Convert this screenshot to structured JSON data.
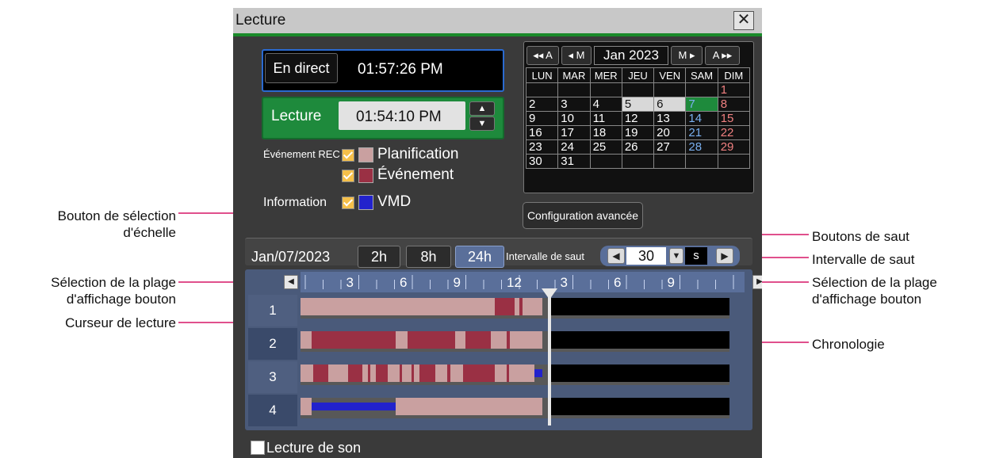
{
  "annotations": {
    "scale_button": "Bouton de sélection\nd'échelle",
    "display_range_left": "Sélection de la plage\nd'affichage bouton",
    "playback_cursor": "Curseur de lecture",
    "jump_buttons": "Boutons de saut",
    "jump_interval": "Intervalle de saut",
    "display_range_right": "Sélection de la plage\nd'affichage bouton",
    "timeline": "Chronologie"
  },
  "window": {
    "title": "Lecture",
    "close": "✕"
  },
  "live": {
    "button": "En direct",
    "time": "01:57:26 PM"
  },
  "playback": {
    "button": "Lecture",
    "time": "01:54:10 PM"
  },
  "filters": {
    "rec_label": "Événement REC",
    "schedule": "Planification",
    "event": "Événement",
    "info_label": "Information",
    "vmd": "VMD"
  },
  "advanced": "Configuration avancée",
  "calendar": {
    "nav": [
      "◂◂ A",
      "◂ M",
      "Jan 2023",
      "M ▸",
      "A ▸▸"
    ],
    "days": [
      "LUN",
      "MAR",
      "MER",
      "JEU",
      "VEN",
      "SAM",
      "DIM"
    ],
    "weeks": [
      [
        "",
        "",
        "",
        "",
        "",
        "",
        "1"
      ],
      [
        "2",
        "3",
        "4",
        "5",
        "6",
        "7",
        "8"
      ],
      [
        "9",
        "10",
        "11",
        "12",
        "13",
        "14",
        "15"
      ],
      [
        "16",
        "17",
        "18",
        "19",
        "20",
        "21",
        "22"
      ],
      [
        "23",
        "24",
        "25",
        "26",
        "27",
        "28",
        "29"
      ],
      [
        "30",
        "31",
        "",
        "",
        "",
        "",
        ""
      ]
    ],
    "selected": "7",
    "recorded": [
      "5",
      "6"
    ]
  },
  "timeline": {
    "date": "Jan/07/2023",
    "scales": [
      "2h",
      "8h",
      "24h"
    ],
    "active_scale": "24h",
    "jump_label": "Intervalle de saut",
    "jump_value": "30",
    "jump_unit": "s",
    "ticks": [
      "3",
      "6",
      "9",
      "12",
      "3",
      "6",
      "9"
    ],
    "cameras": [
      "1",
      "2",
      "3",
      "4"
    ],
    "audio": "Lecture de son"
  },
  "colors": {
    "schedule": "#c9a0a0",
    "event": "#9a3044",
    "vmd": "#2222cc",
    "accent_green": "#1e8a3c",
    "accent_blue": "#2a6ad0"
  }
}
